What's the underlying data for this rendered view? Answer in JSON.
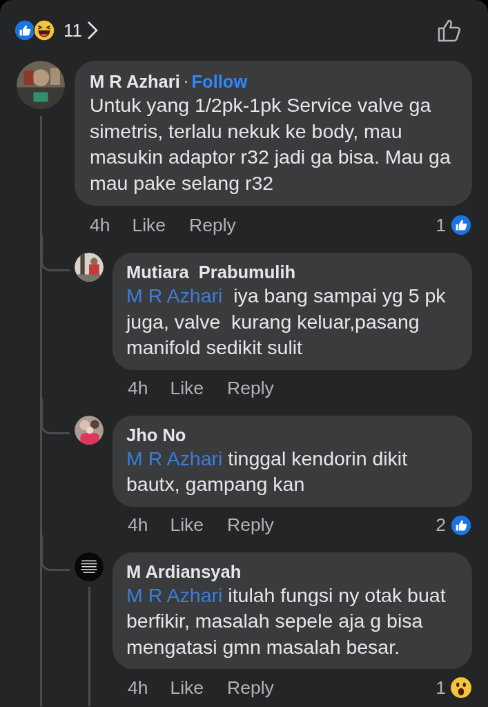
{
  "top_bar": {
    "reactions": [
      {
        "kind": "like"
      },
      {
        "kind": "haha"
      }
    ],
    "count": "11"
  },
  "comment": {
    "author": "M R Azhari",
    "separator": "·",
    "follow": "Follow",
    "text": "Untuk yang 1/2pk-1pk Service valve ga simetris, terlalu nekuk ke body, mau masukin adaptor r32 jadi ga bisa. Mau ga mau pake selang r32",
    "time": "4h",
    "like": "Like",
    "reply": "Reply",
    "reaction": {
      "count": "1",
      "kind": "like"
    },
    "thread_line": true,
    "replies": [
      {
        "author": "Mutiara  Prabumulih",
        "mention": "M R Azhari",
        "text": "  iya bang sampai yg 5 pk juga, valve  kurang keluar,pasang manifold sedikit sulit",
        "time": "4h",
        "like": "Like",
        "reply": "Reply",
        "thread_line": false
      },
      {
        "author": "Jho No",
        "mention": "M R Azhari",
        "text": " tinggal kendorin dikit bautx, gampang kan",
        "time": "4h",
        "like": "Like",
        "reply": "Reply",
        "reaction": {
          "count": "2",
          "kind": "like"
        },
        "thread_line": false
      },
      {
        "author": "M Ardiansyah",
        "mention": "M R Azhari",
        "text": " itulah fungsi ny otak buat berfikir, masalah sepele aja g bisa mengatasi gmn masalah besar.",
        "time": "4h",
        "like": "Like",
        "reply": "Reply",
        "reaction": {
          "count": "1",
          "kind": "wow"
        },
        "thread_line": true
      }
    ]
  }
}
